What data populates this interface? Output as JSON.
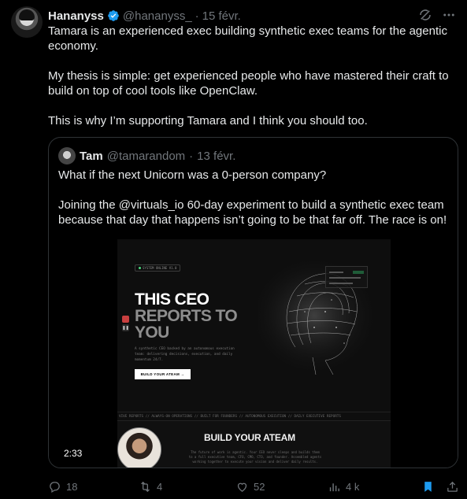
{
  "author": {
    "name": "Hananyss",
    "handle": "@hananyss_",
    "date": "15 févr.",
    "verified": true,
    "verified_color": "#1d9bf0"
  },
  "body": {
    "p1": "Tamara is an experienced exec building synthetic exec teams for the agentic economy.",
    "p2": "My thesis is simple: get experienced people who have mastered their craft to build on top of cool tools like OpenClaw.",
    "p3": "This is why I’m supporting Tamara and I think you should too."
  },
  "separator": "·",
  "quoted": {
    "name": "Tam",
    "handle": "@tamarandom",
    "date": "13 févr.",
    "p1": "What if the next Unicorn was a 0-person company?",
    "p2": "Joining the @virtuals_io 60-day experiment to build a synthetic exec team because that day that happens isn’t going to be that far off. The race is on!",
    "media": {
      "duration": "2:33",
      "badge": "SYSTEM ONLINE V1.0",
      "title_line1": "THIS CEO",
      "title_line2": "REPORTS TO",
      "title_line3": "YOU",
      "subtitle": "A synthetic CEO backed by an autonomous execution team: delivering decisions, execution, and daily momentum 24/7.",
      "cta": "BUILD YOUR ATEAM →",
      "ticker": "VIVE REPORTS  //  ALWAYS-ON OPERATIONS  //  BUILT FOR FOUNDERS  //  AUTONOMOUS EXECUTION  //  DAILY EXECUTIVE REPORTS",
      "build_title": "BUILD YOUR ATEAM",
      "build_sub": "The future of work is agentic. Your CEO never sleeps and builds them to a full executive team, CFO, CMO, CTO, and founder. Assembled agents working together to execute your vision and deliver daily results."
    }
  },
  "actions": {
    "replies": "18",
    "reposts": "4",
    "likes": "52",
    "views": "4 k"
  },
  "icons": {
    "top": [
      "grok-icon",
      "more-icon"
    ],
    "actions": [
      "reply-icon",
      "repost-icon",
      "like-icon",
      "views-icon",
      "bookmark-icon",
      "share-icon"
    ]
  },
  "colors": {
    "background": "#000000",
    "text": "#e7e9ea",
    "muted": "#71767b",
    "border": "#2f3336",
    "bookmark_active": "#1d9bf0"
  }
}
